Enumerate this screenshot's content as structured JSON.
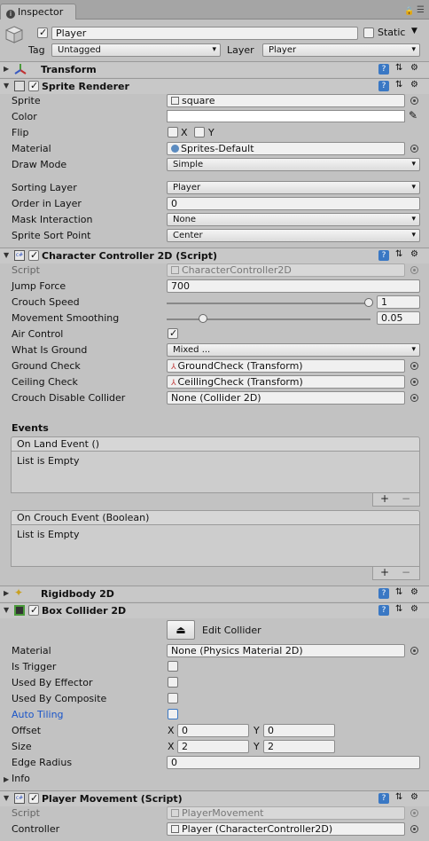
{
  "tab": {
    "label": "Inspector"
  },
  "header": {
    "name": "Player",
    "static_label": "Static",
    "tag_label": "Tag",
    "tag_value": "Untagged",
    "layer_label": "Layer",
    "layer_value": "Player"
  },
  "transform": {
    "title": "Transform"
  },
  "sprite_renderer": {
    "title": "Sprite Renderer",
    "sprite_label": "Sprite",
    "sprite_value": "square",
    "color_label": "Color",
    "flip_label": "Flip",
    "flip_x": "X",
    "flip_y": "Y",
    "material_label": "Material",
    "material_value": "Sprites-Default",
    "draw_mode_label": "Draw Mode",
    "draw_mode_value": "Simple",
    "sorting_layer_label": "Sorting Layer",
    "sorting_layer_value": "Player",
    "order_label": "Order in Layer",
    "order_value": "0",
    "mask_label": "Mask Interaction",
    "mask_value": "None",
    "sort_point_label": "Sprite Sort Point",
    "sort_point_value": "Center"
  },
  "character_controller": {
    "title": "Character Controller 2D (Script)",
    "script_label": "Script",
    "script_value": "CharacterController2D",
    "jump_label": "Jump Force",
    "jump_value": "700",
    "crouch_label": "Crouch Speed",
    "crouch_value": "1",
    "smooth_label": "Movement Smoothing",
    "smooth_value": "0.05",
    "air_label": "Air Control",
    "ground_label": "What Is Ground",
    "ground_value": "Mixed ...",
    "ground_check_label": "Ground Check",
    "ground_check_value": "GroundCheck (Transform)",
    "ceiling_label": "Ceiling Check",
    "ceiling_value": "CeillingCheck (Transform)",
    "crouch_disable_label": "Crouch Disable Collider",
    "crouch_disable_value": "None (Collider 2D)",
    "events_label": "Events",
    "land_event": "On Land Event ()",
    "crouch_event": "On Crouch Event (Boolean)",
    "empty": "List is Empty",
    "plus": "+",
    "minus": "−"
  },
  "rigidbody": {
    "title": "Rigidbody 2D"
  },
  "box_collider": {
    "title": "Box Collider 2D",
    "edit_label": "Edit Collider",
    "material_label": "Material",
    "material_value": "None (Physics Material 2D)",
    "trigger_label": "Is Trigger",
    "effector_label": "Used By Effector",
    "composite_label": "Used By Composite",
    "tiling_label": "Auto Tiling",
    "offset_label": "Offset",
    "offset_x": "0",
    "offset_y": "0",
    "size_label": "Size",
    "size_x": "2",
    "size_y": "2",
    "x": "X",
    "y": "Y",
    "radius_label": "Edge Radius",
    "radius_value": "0",
    "info_label": "Info"
  },
  "player_movement": {
    "title": "Player Movement (Script)",
    "script_label": "Script",
    "script_value": "PlayerMovement",
    "controller_label": "Controller",
    "controller_value": "Player (CharacterController2D)"
  },
  "colors": {
    "accent": "#3a78c4",
    "tiling_label": "#1a55c9"
  }
}
